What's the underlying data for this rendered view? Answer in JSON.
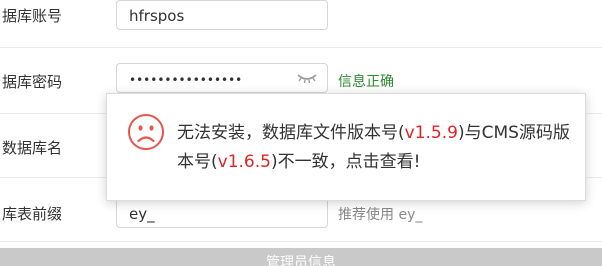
{
  "form": {
    "db_user": {
      "label": "据库账号",
      "value": "hfrspos"
    },
    "db_pass": {
      "label": "据库密码",
      "value": "••••••••••••••••",
      "status": "信息正确"
    },
    "db_name": {
      "label": "数据库名"
    },
    "db_prefix": {
      "label": "库表前缀",
      "value": "ey_",
      "hint": "推荐使用 ey_"
    },
    "section": {
      "title": "管理员信息"
    }
  },
  "dialog": {
    "msg_1": "无法安装，数据库文件版本号(",
    "db_version": "v1.5.9",
    "msg_2": ")与CMS源码版本号(",
    "cms_version": "v1.6.5",
    "msg_3": ")不一致，点击查看!"
  },
  "colors": {
    "ok": "#2e8b2e",
    "error": "#e02424"
  },
  "icons": {
    "password_toggle": "eye-closed-icon",
    "dialog_status": "sad-face-icon"
  }
}
